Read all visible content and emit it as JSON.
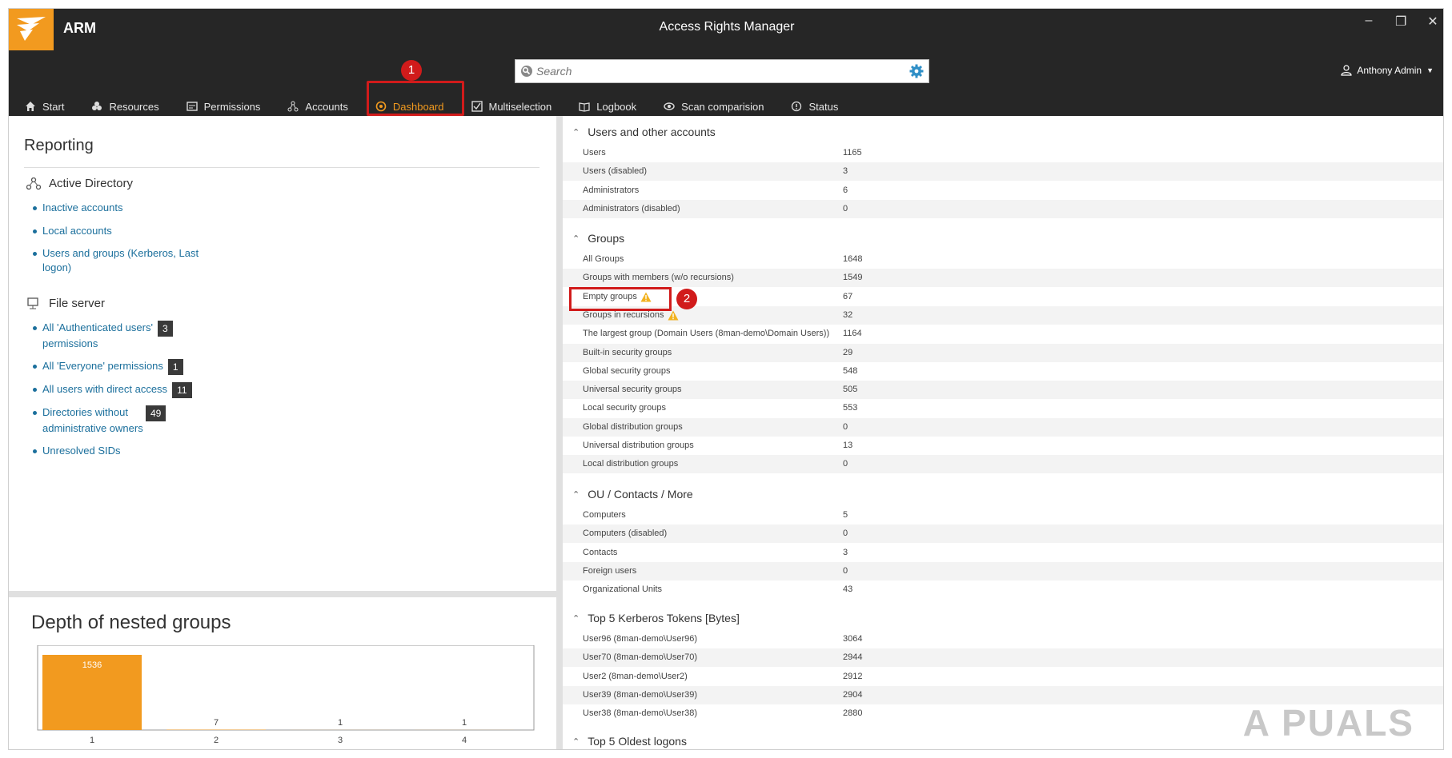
{
  "app": {
    "name": "ARM",
    "window_title": "Access Rights Manager",
    "window_controls": [
      "–",
      "❐",
      "✕"
    ]
  },
  "search": {
    "placeholder": "Search"
  },
  "user": {
    "name": "Anthony Admin"
  },
  "nav": {
    "items": [
      {
        "label": "Start",
        "icon": "home-icon"
      },
      {
        "label": "Resources",
        "icon": "resources-icon"
      },
      {
        "label": "Permissions",
        "icon": "permissions-icon"
      },
      {
        "label": "Accounts",
        "icon": "accounts-icon"
      },
      {
        "label": "Dashboard",
        "icon": "dashboard-icon",
        "active": true
      },
      {
        "label": "Multiselection",
        "icon": "multiselection-icon"
      },
      {
        "label": "Logbook",
        "icon": "logbook-icon"
      },
      {
        "label": "Scan comparision",
        "icon": "scan-comparison-icon"
      },
      {
        "label": "Status",
        "icon": "status-icon"
      }
    ]
  },
  "annotations": {
    "step1": "1",
    "step2": "2"
  },
  "reporting": {
    "title": "Reporting",
    "active_directory": {
      "title": "Active Directory",
      "links": [
        "Inactive accounts",
        "Local accounts",
        "Users and groups (Kerberos, Last",
        "logon)"
      ]
    },
    "file_server": {
      "title": "File server",
      "links": [
        {
          "line1": "All 'Authenticated users'",
          "line2": "permissions",
          "count": "3"
        },
        {
          "line1": "All 'Everyone' permissions",
          "count": "1"
        },
        {
          "line1": "All users with direct access",
          "count": "11"
        },
        {
          "line1": "Directories without",
          "line2": "administrative owners",
          "count": "49"
        },
        {
          "line1": "Unresolved SIDs"
        }
      ]
    }
  },
  "chart_data": {
    "type": "bar",
    "title": "Depth of nested groups",
    "categories": [
      "1",
      "2",
      "3",
      "4"
    ],
    "values": [
      1536,
      7,
      1,
      1
    ],
    "colors": {
      "bar": "#f29a1f"
    }
  },
  "dashboard": {
    "users": {
      "title": "Users and other accounts",
      "rows": [
        {
          "label": "Users",
          "value": "1165"
        },
        {
          "label": "Users (disabled)",
          "value": "3"
        },
        {
          "label": "Administrators",
          "value": "6"
        },
        {
          "label": "Administrators (disabled)",
          "value": "0"
        }
      ]
    },
    "groups": {
      "title": "Groups",
      "rows": [
        {
          "label": "All Groups",
          "value": "1648"
        },
        {
          "label": "Groups with members (w/o recursions)",
          "value": "1549"
        },
        {
          "label": "Empty groups",
          "value": "67",
          "warning": true
        },
        {
          "label": "Groups in recursions",
          "value": "32",
          "warning": true
        },
        {
          "label": "The largest group (Domain Users (8man-demo\\Domain Users))",
          "value": "1164"
        },
        {
          "label": "Built-in security groups",
          "value": "29"
        },
        {
          "label": "Global security groups",
          "value": "548"
        },
        {
          "label": "Universal security groups",
          "value": "505"
        },
        {
          "label": "Local security groups",
          "value": "553"
        },
        {
          "label": "Global distribution groups",
          "value": "0"
        },
        {
          "label": "Universal distribution groups",
          "value": "13"
        },
        {
          "label": "Local distribution groups",
          "value": "0"
        }
      ]
    },
    "ou": {
      "title": "OU / Contacts / More",
      "rows": [
        {
          "label": "Computers",
          "value": "5"
        },
        {
          "label": "Computers (disabled)",
          "value": "0"
        },
        {
          "label": "Contacts",
          "value": "3"
        },
        {
          "label": "Foreign users",
          "value": "0"
        },
        {
          "label": "Organizational Units",
          "value": "43"
        }
      ]
    },
    "kerberos": {
      "title": "Top 5 Kerberos Tokens [Bytes]",
      "rows": [
        {
          "label": "User96 (8man-demo\\User96)",
          "value": "3064"
        },
        {
          "label": "User70 (8man-demo\\User70)",
          "value": "2944"
        },
        {
          "label": "User2 (8man-demo\\User2)",
          "value": "2912"
        },
        {
          "label": "User39 (8man-demo\\User39)",
          "value": "2904"
        },
        {
          "label": "User38 (8man-demo\\User38)",
          "value": "2880"
        }
      ]
    },
    "oldest": {
      "title": "Top 5 Oldest logons"
    }
  },
  "watermark": "A  PUALS"
}
